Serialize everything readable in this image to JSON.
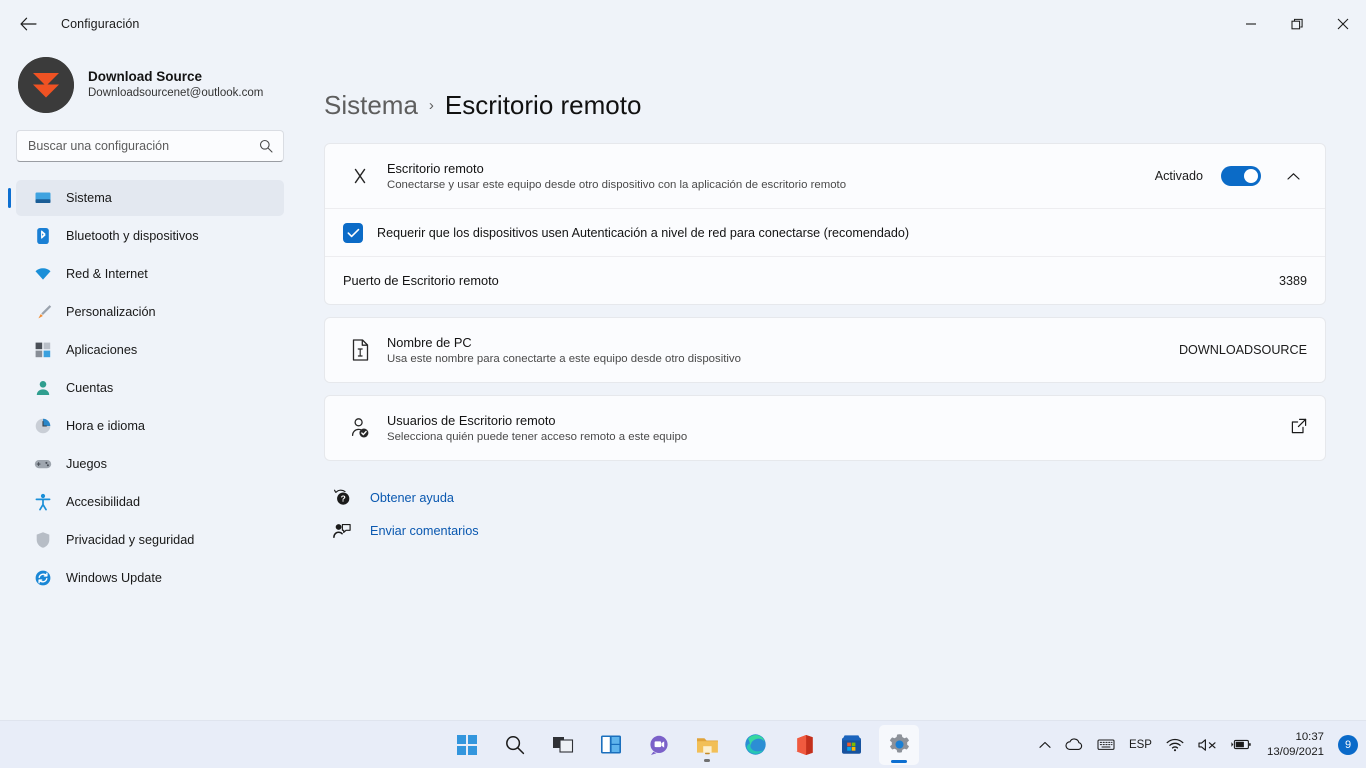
{
  "window": {
    "title": "Configuración",
    "back_icon": "back-arrow-icon",
    "minimize_label": "Minimizar",
    "maximize_label": "Restaurar",
    "close_label": "Cerrar"
  },
  "account": {
    "name": "Download Source",
    "email": "Downloadsourcenet@outlook.com"
  },
  "search": {
    "placeholder": "Buscar una configuración",
    "value": "",
    "icon": "search-icon"
  },
  "sidebar": {
    "items": [
      {
        "label": "Sistema",
        "icon": "system-monitor-icon",
        "active": true
      },
      {
        "label": "Bluetooth y dispositivos",
        "icon": "bluetooth-icon",
        "active": false
      },
      {
        "label": "Red & Internet",
        "icon": "wifi-icon",
        "active": false
      },
      {
        "label": "Personalización",
        "icon": "paintbrush-icon",
        "active": false
      },
      {
        "label": "Aplicaciones",
        "icon": "apps-grid-icon",
        "active": false
      },
      {
        "label": "Cuentas",
        "icon": "person-icon",
        "active": false
      },
      {
        "label": "Hora e idioma",
        "icon": "clock-icon",
        "active": false
      },
      {
        "label": "Juegos",
        "icon": "gamepad-icon",
        "active": false
      },
      {
        "label": "Accesibilidad",
        "icon": "accessibility-person-icon",
        "active": false
      },
      {
        "label": "Privacidad y seguridad",
        "icon": "shield-icon",
        "active": false
      },
      {
        "label": "Windows Update",
        "icon": "update-refresh-icon",
        "active": false
      }
    ]
  },
  "breadcrumb": {
    "parent": "Sistema",
    "separator": "›",
    "current": "Escritorio remoto"
  },
  "main": {
    "remote_desktop": {
      "icon": "remote-connect-icon",
      "title": "Escritorio remoto",
      "subtitle": "Conectarse y usar este equipo desde otro dispositivo con la aplicación de escritorio remoto",
      "toggle_state_label": "Activado",
      "toggle_on": true,
      "expand_icon": "chevron-up-icon",
      "nla": {
        "checked": true,
        "label": "Requerir que los dispositivos usen Autenticación a nivel de red para conectarse (recomendado)"
      },
      "port": {
        "label": "Puerto de Escritorio remoto",
        "value": "3389"
      }
    },
    "pc_name": {
      "icon": "document-info-icon",
      "title": "Nombre de PC",
      "subtitle": "Usa este nombre para conectarte a este equipo desde otro dispositivo",
      "value": "DOWNLOADSOURCE"
    },
    "rd_users": {
      "icon": "user-check-icon",
      "title": "Usuarios de Escritorio remoto",
      "subtitle": "Selecciona quién puede tener acceso remoto a este equipo",
      "action_icon": "open-external-icon"
    },
    "help_links": [
      {
        "label": "Obtener ayuda",
        "icon": "help-question-icon"
      },
      {
        "label": "Enviar comentarios",
        "icon": "feedback-icon"
      }
    ]
  },
  "taskbar": {
    "items": [
      {
        "name": "start",
        "label": "Inicio"
      },
      {
        "name": "search",
        "label": "Buscar"
      },
      {
        "name": "task-view",
        "label": "Vista de tareas"
      },
      {
        "name": "widgets",
        "label": "Widgets"
      },
      {
        "name": "chat",
        "label": "Chat"
      },
      {
        "name": "file-explorer",
        "label": "Explorador de archivos"
      },
      {
        "name": "edge",
        "label": "Microsoft Edge"
      },
      {
        "name": "office",
        "label": "Office"
      },
      {
        "name": "store",
        "label": "Microsoft Store"
      },
      {
        "name": "settings",
        "label": "Configuración"
      }
    ],
    "tray": {
      "overflow_icon": "chevron-up-icon",
      "onedrive_icon": "onedrive-cloud-icon",
      "ime_icon": "keyboard-icon",
      "language": "ESP",
      "wifi_icon": "wifi-icon",
      "volume_icon": "volume-muted-icon",
      "battery_icon": "battery-charging-icon",
      "time": "10:37",
      "date": "13/09/2021",
      "notification_count": "9"
    }
  },
  "colors": {
    "accent": "#0b6bc7",
    "link": "#0a58b0",
    "window_bg": "#eff3f9",
    "card_bg": "#fbfcfe"
  }
}
